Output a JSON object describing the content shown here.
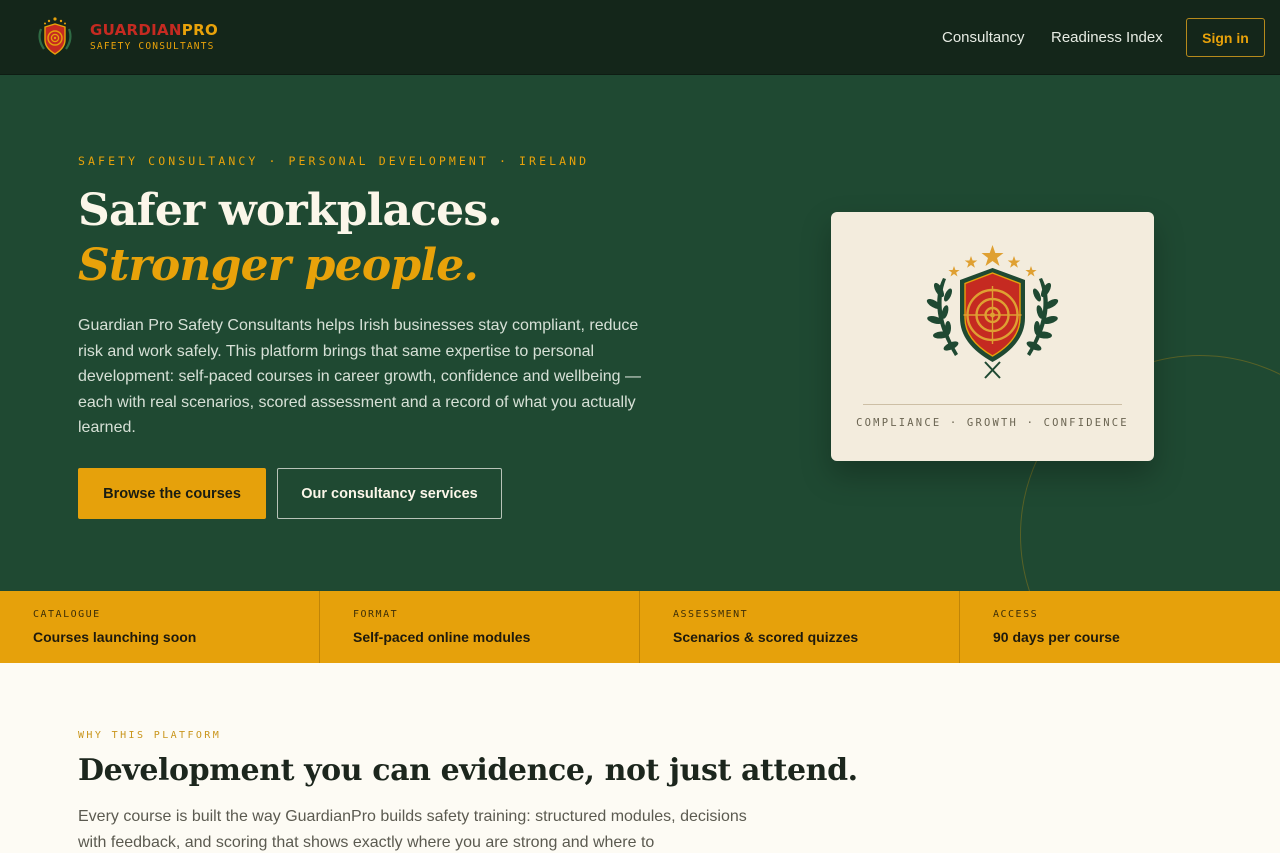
{
  "nav": {
    "brand_primary": "GUARDIAN",
    "brand_secondary": "PRO",
    "brand_tagline": "SAFETY CONSULTANTS",
    "links": [
      "Consultancy",
      "Readiness Index"
    ],
    "signin_label": "Sign in"
  },
  "hero": {
    "eyebrow": "SAFETY CONSULTANCY · PERSONAL DEVELOPMENT · IRELAND",
    "headline_plain": "Safer workplaces.",
    "headline_accent": "Stronger people.",
    "lead": "Guardian Pro Safety Consultants helps Irish businesses stay compliant, reduce risk and work safely. This platform brings that same expertise to personal development: self-paced courses in career growth, confidence and wellbeing — each with real scenarios, scored assessment and a record of what you actually learned.",
    "primary_cta": "Browse the courses",
    "secondary_cta": "Our consultancy services",
    "card_tagline": "COMPLIANCE · GROWTH · CONFIDENCE"
  },
  "stats": [
    {
      "label": "CATALOGUE",
      "value": "Courses launching soon"
    },
    {
      "label": "FORMAT",
      "value": "Self-paced online modules"
    },
    {
      "label": "ASSESSMENT",
      "value": "Scenarios & scored quizzes"
    },
    {
      "label": "ACCESS",
      "value": "90 days per course"
    }
  ],
  "why": {
    "eyebrow": "WHY THIS PLATFORM",
    "title": "Development you can evidence, not just attend.",
    "body": "Every course is built the way GuardianPro builds safety training: structured modules, decisions with feedback, and scoring that shows exactly where you are strong and where to"
  },
  "colors": {
    "header_bg": "#14261a",
    "hero_bg": "#1f4932",
    "accent_gold": "#e6a10b",
    "brand_red": "#c52a21",
    "card_bg": "#f3ecdd",
    "page_bg": "#fdfbf4"
  },
  "icons": {
    "brand_logo": "shield-target-icon",
    "crest": "laurel-shield-target-emblem"
  }
}
